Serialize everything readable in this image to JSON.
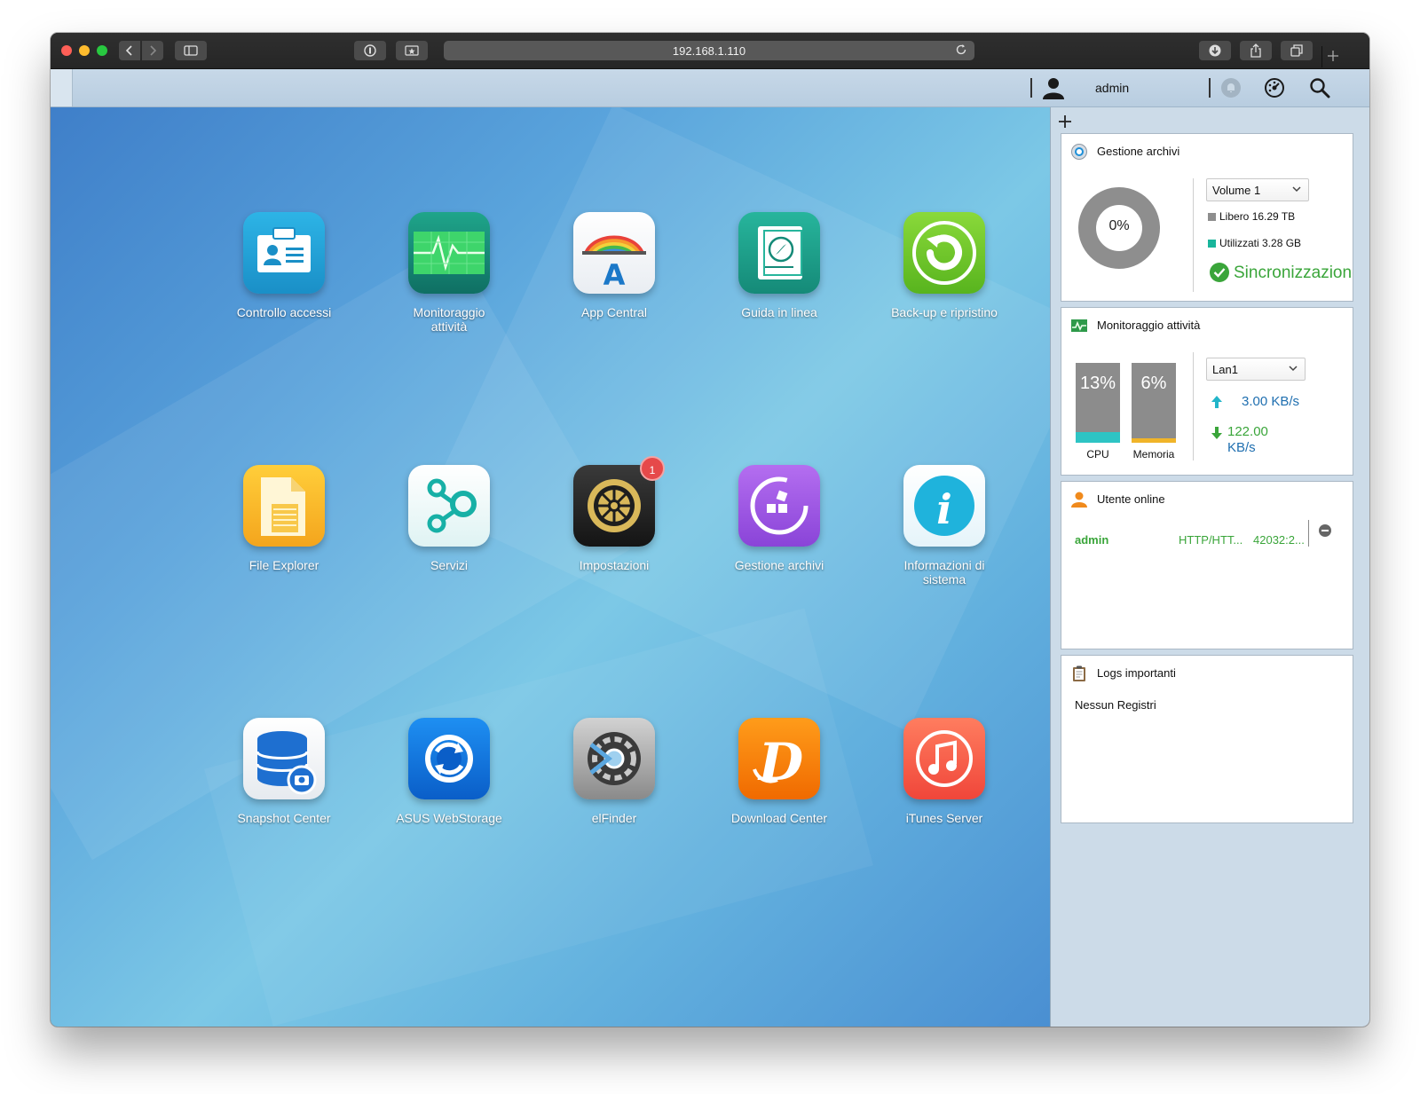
{
  "browser": {
    "url": "192.168.1.110"
  },
  "topbar": {
    "user": "admin"
  },
  "apps": [
    {
      "label": "Controllo accessi"
    },
    {
      "label": "Monitoraggio attività"
    },
    {
      "label": "App Central"
    },
    {
      "label": "Guida in linea"
    },
    {
      "label": "Back-up e ripristino"
    },
    {
      "label": "File Explorer"
    },
    {
      "label": "Servizi"
    },
    {
      "label": "Impostazioni",
      "badge": "1"
    },
    {
      "label": "Gestione archivi"
    },
    {
      "label": "Informazioni di sistema"
    },
    {
      "label": "Snapshot Center"
    },
    {
      "label": "ASUS WebStorage"
    },
    {
      "label": "elFinder"
    },
    {
      "label": "Download Center"
    },
    {
      "label": "iTunes Server"
    }
  ],
  "widgets": {
    "storage": {
      "title": "Gestione archivi",
      "usage_pct": "0%",
      "volume": "Volume 1",
      "free": "Libero 16.29 TB",
      "used": "Utilizzati 3.28 GB",
      "status": "Sincronizzazione"
    },
    "activity": {
      "title": "Monitoraggio attività",
      "cpu_pct": "13%",
      "cpu_fill": 0.13,
      "cpu_label": "CPU",
      "mem_pct": "6%",
      "mem_fill": 0.06,
      "mem_label": "Memoria",
      "interface": "Lan1",
      "upload": "3.00 KB/s",
      "download_value": "122.00",
      "download_unit": "KB/s"
    },
    "users": {
      "title": "Utente online",
      "rows": [
        {
          "user": "admin",
          "protocol": "HTTP/HTT...",
          "address": "42032:2..."
        }
      ]
    },
    "logs": {
      "title": "Logs importanti",
      "empty": "Nessun Registri"
    }
  },
  "colors": {
    "accent_green": "#3aa53a",
    "cpu_fill": "#2ec4c4",
    "mem_fill": "#f0b429",
    "user_icon": "#f08a1c"
  }
}
